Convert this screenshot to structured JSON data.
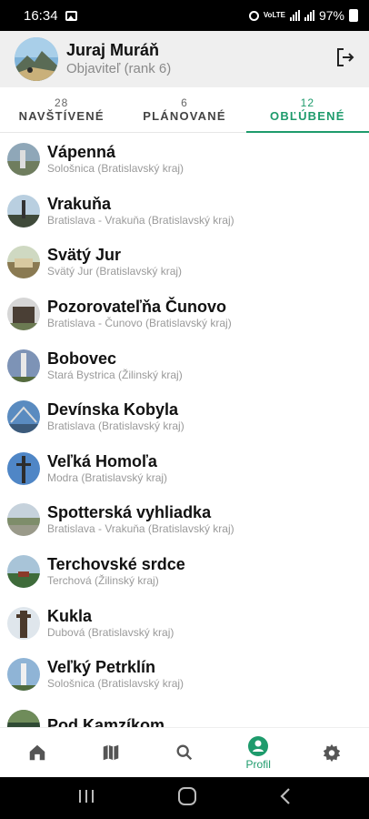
{
  "status_bar": {
    "time": "16:34",
    "network_label": "VoLTE",
    "battery": "97%"
  },
  "header": {
    "user_name": "Juraj Muráň",
    "user_rank": "Objaviteľ (rank 6)"
  },
  "tabs": [
    {
      "count": "28",
      "label": "NAVŠTÍVENÉ"
    },
    {
      "count": "6",
      "label": "PLÁNOVANÉ"
    },
    {
      "count": "12",
      "label": "OBĽÚBENÉ",
      "active": true
    }
  ],
  "places": [
    {
      "title": "Vápenná",
      "subtitle": "Sološnica (Bratislavský kraj)"
    },
    {
      "title": "Vrakuňa",
      "subtitle": "Bratislava - Vrakuňa (Bratislavský kraj)"
    },
    {
      "title": "Svätý Jur",
      "subtitle": "Svätý Jur (Bratislavský kraj)"
    },
    {
      "title": "Pozorovateľňa Čunovo",
      "subtitle": "Bratislava - Čunovo (Bratislavský kraj)"
    },
    {
      "title": "Bobovec",
      "subtitle": "Stará Bystrica (Žilinský kraj)"
    },
    {
      "title": "Devínska Kobyla",
      "subtitle": "Bratislava (Bratislavský kraj)"
    },
    {
      "title": "Veľká Homoľa",
      "subtitle": "Modra (Bratislavský kraj)"
    },
    {
      "title": "Spotterská vyhliadka",
      "subtitle": "Bratislava - Vrakuňa (Bratislavský kraj)"
    },
    {
      "title": "Terchovské srdce",
      "subtitle": "Terchová (Žilinský kraj)"
    },
    {
      "title": "Kukla",
      "subtitle": "Dubová (Bratislavský kraj)"
    },
    {
      "title": "Veľký Petrklín",
      "subtitle": "Sološnica (Bratislavský kraj)"
    },
    {
      "title": "Pod Kamzíkom",
      "subtitle": ""
    }
  ],
  "bottom_nav": {
    "items": [
      "home-icon",
      "map-icon",
      "search-icon",
      "profile-icon",
      "gear-icon"
    ],
    "profile_label": "Profil",
    "active_color": "#1e9b6c"
  }
}
